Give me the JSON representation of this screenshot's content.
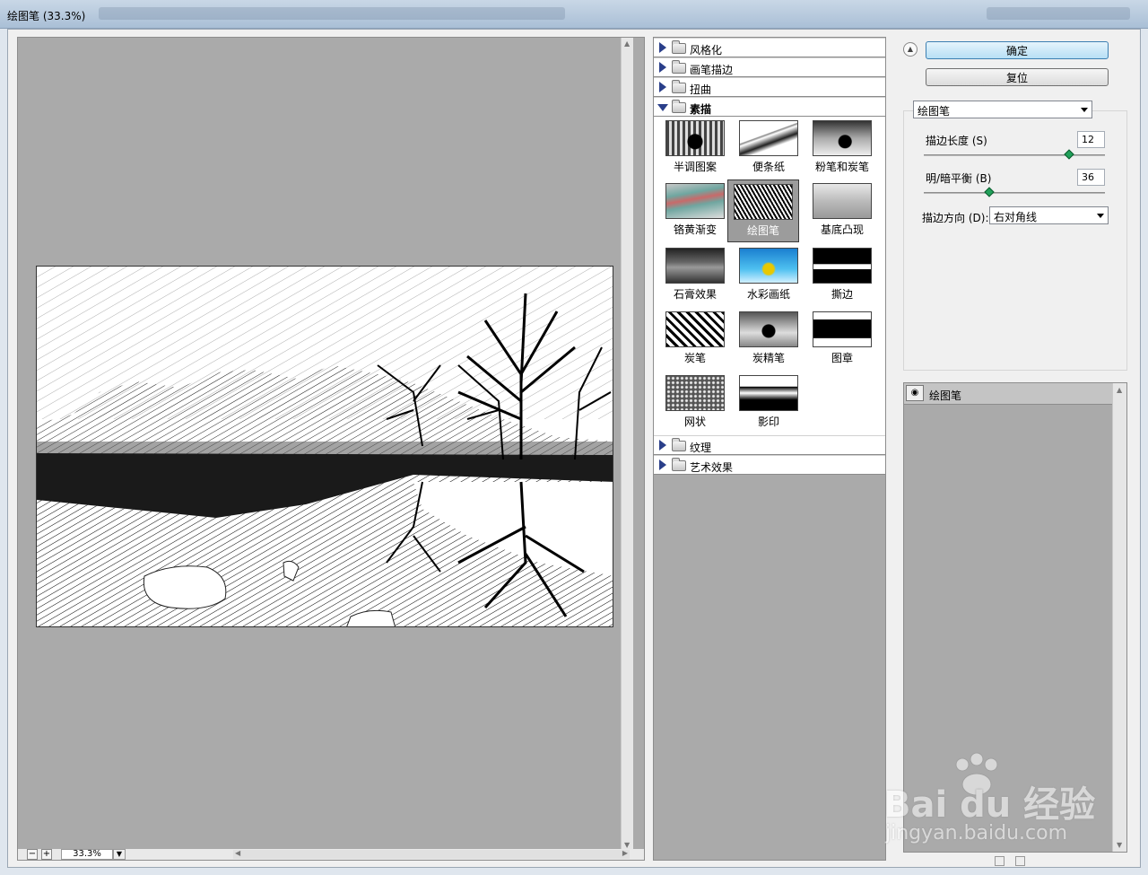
{
  "window": {
    "title": "绘图笔 (33.3%)"
  },
  "preview": {
    "zoom": "33.3%",
    "zoom_minus": "−",
    "zoom_plus": "+"
  },
  "categories": [
    {
      "label": "风格化",
      "open": false
    },
    {
      "label": "画笔描边",
      "open": false
    },
    {
      "label": "扭曲",
      "open": false
    },
    {
      "label": "素描",
      "open": true
    },
    {
      "label": "纹理",
      "open": false
    },
    {
      "label": "艺术效果",
      "open": false
    }
  ],
  "filters": [
    "半调图案",
    "便条纸",
    "粉笔和炭笔",
    "铬黄渐变",
    "绘图笔",
    "基底凸现",
    "石膏效果",
    "水彩画纸",
    "撕边",
    "炭笔",
    "炭精笔",
    "图章",
    "网状",
    "影印"
  ],
  "selected_filter": "绘图笔",
  "buttons": {
    "ok": "确定",
    "reset": "复位"
  },
  "settings": {
    "filter_select": "绘图笔",
    "stroke_length_label": "描边长度",
    "stroke_length_key": "(S)",
    "stroke_length_value": "12",
    "stroke_length_fraction": 0.8,
    "light_dark_label": "明/暗平衡",
    "light_dark_key": "(B)",
    "light_dark_value": "36",
    "light_dark_fraction": 0.36,
    "direction_label": "描边方向",
    "direction_key": "(D):",
    "direction_value": "右对角线"
  },
  "layers": [
    {
      "name": "绘图笔",
      "visible": true
    }
  ],
  "watermark": {
    "brand": "Bai du 经验",
    "url": "jingyan.baidu.com"
  }
}
